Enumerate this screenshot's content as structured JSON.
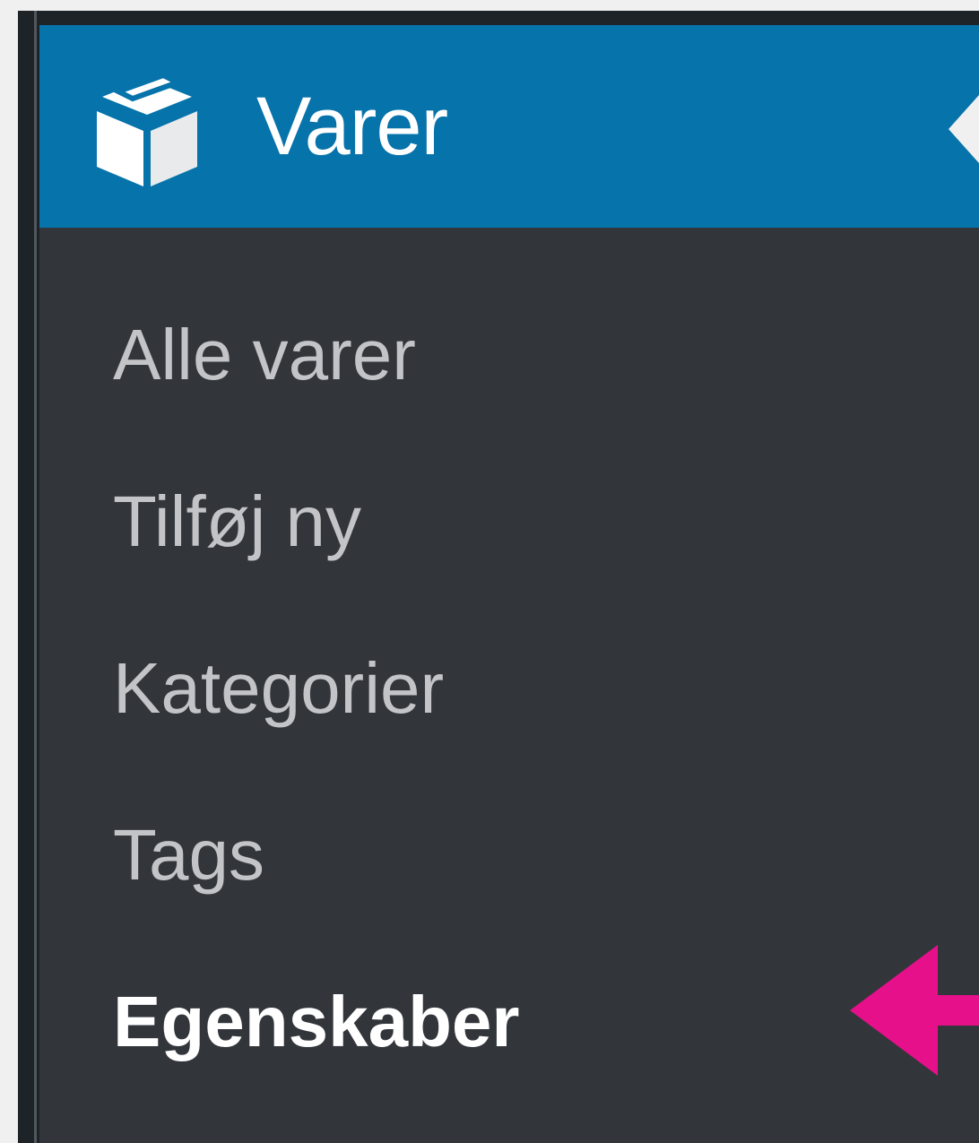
{
  "menu": {
    "title": "Varer",
    "icon": "box-icon",
    "accent_color": "#0673aa",
    "items": [
      {
        "label": "Alle varer",
        "active": false
      },
      {
        "label": "Tilføj ny",
        "active": false
      },
      {
        "label": "Kategorier",
        "active": false
      },
      {
        "label": "Tags",
        "active": false
      },
      {
        "label": "Egenskaber",
        "active": true
      }
    ]
  },
  "annotation": {
    "icon": "arrow-left-icon",
    "color": "#e5108a"
  }
}
